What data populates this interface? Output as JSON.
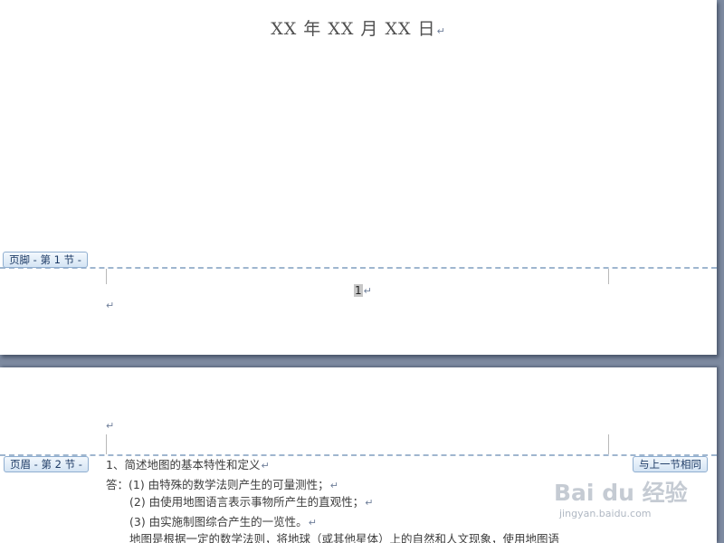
{
  "page1": {
    "date_text": "XX 年 XX 月 XX 日",
    "footer_label": "页脚 - 第 1 节 -",
    "page_number": "1"
  },
  "page2": {
    "header_label": "页眉 - 第 2 节 -",
    "same_as_previous_label": "与上一节相同",
    "lines": [
      "1、简述地图的基本特性和定义",
      "答：(1)  由特殊的数学法则产生的可量测性；",
      "(2)  由使用地图语言表示事物所产生的直观性；",
      "(3)  由实施制图综合产生的一览性。",
      "地图是根据一定的数学法则，将地球（或其他星体）上的自然和人文现象，使用地图语"
    ]
  },
  "marks": {
    "paragraph_mark": "↵"
  },
  "watermark": {
    "logo_text": "Bai du 经验",
    "url_text": "jingyan.baidu.com"
  },
  "colors": {
    "workspace_bg": "#7d8aa0",
    "dashed_line": "#9fb6cf",
    "tag_text": "#1d3b66"
  }
}
